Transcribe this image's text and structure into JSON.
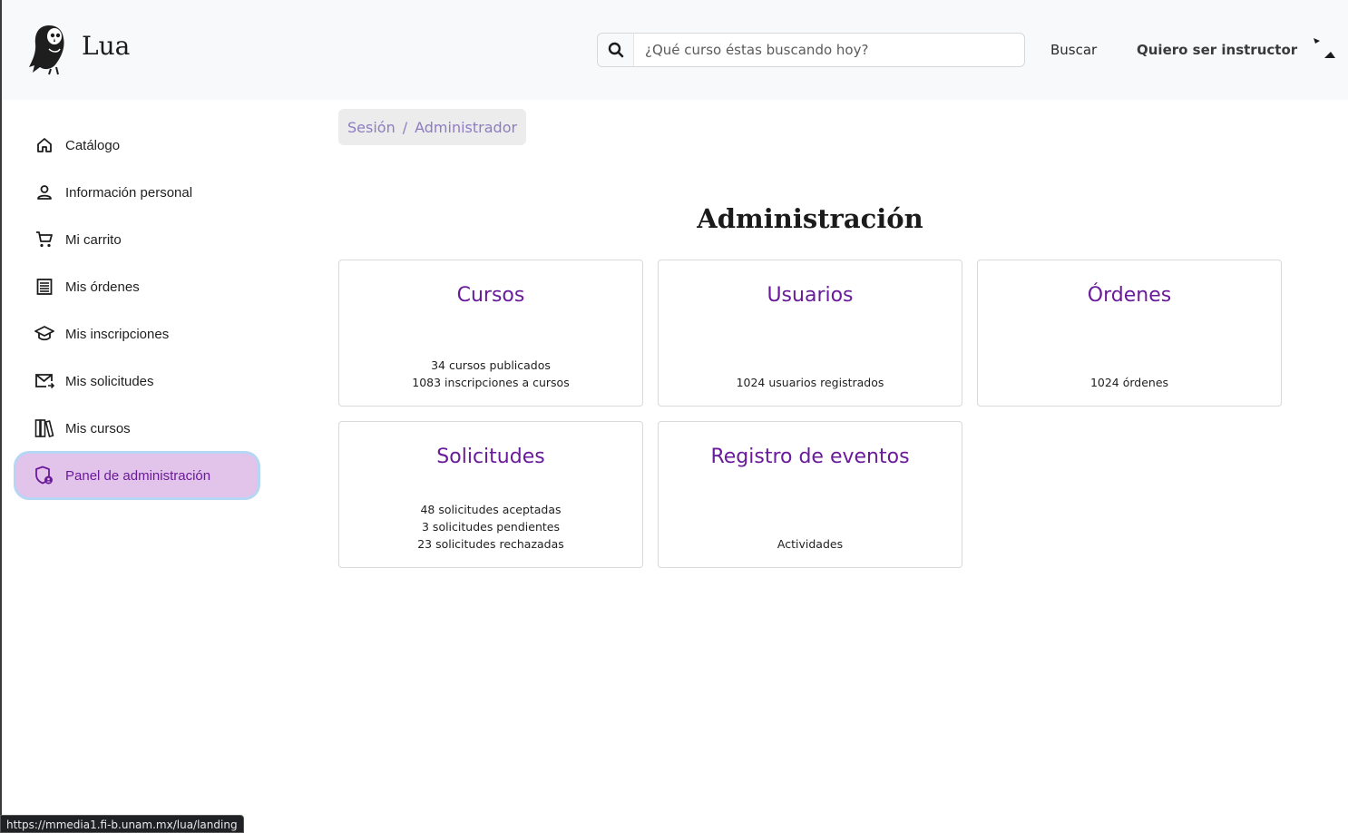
{
  "header": {
    "brand": "Lua",
    "search_placeholder": "¿Qué curso éstas buscando hoy?",
    "search_icon": "search-icon",
    "buscar_label": "Buscar",
    "instructor_label": "Quiero ser instructor"
  },
  "sidebar": {
    "items": [
      {
        "label": "Catálogo",
        "icon": "home-icon"
      },
      {
        "label": "Información personal",
        "icon": "person-icon"
      },
      {
        "label": "Mi carrito",
        "icon": "cart-icon"
      },
      {
        "label": "Mis órdenes",
        "icon": "receipt-icon"
      },
      {
        "label": "Mis inscripciones",
        "icon": "graduation-cap-icon"
      },
      {
        "label": "Mis solicitudes",
        "icon": "mail-arrow-icon"
      },
      {
        "label": "Mis cursos",
        "icon": "books-icon"
      },
      {
        "label": "Panel de administración",
        "icon": "admin-shield-icon",
        "active": true
      }
    ]
  },
  "breadcrumb": {
    "items": [
      "Sesión",
      "Administrador"
    ],
    "separator": "/"
  },
  "main": {
    "title": "Administración",
    "cards": [
      {
        "title": "Cursos",
        "lines": [
          "34 cursos publicados",
          "1083 inscripciones a cursos"
        ]
      },
      {
        "title": "Usuarios",
        "lines": [
          "1024 usuarios registrados"
        ]
      },
      {
        "title": "Órdenes",
        "lines": [
          "1024 órdenes"
        ]
      },
      {
        "title": "Solicitudes",
        "lines": [
          "48 solicitudes aceptadas",
          "3 solicitudes pendientes",
          "23 solicitudes rechazadas"
        ]
      },
      {
        "title": "Registro de eventos",
        "lines": [
          "Actividades"
        ]
      }
    ]
  },
  "status_bar": {
    "url": "https://mmedia1.fi-b.unam.mx/lua/landing"
  },
  "colors": {
    "accent": "#6a1b9a",
    "active_bg": "#e2c3ea",
    "breadcrumb_text": "#8e7cc3"
  }
}
